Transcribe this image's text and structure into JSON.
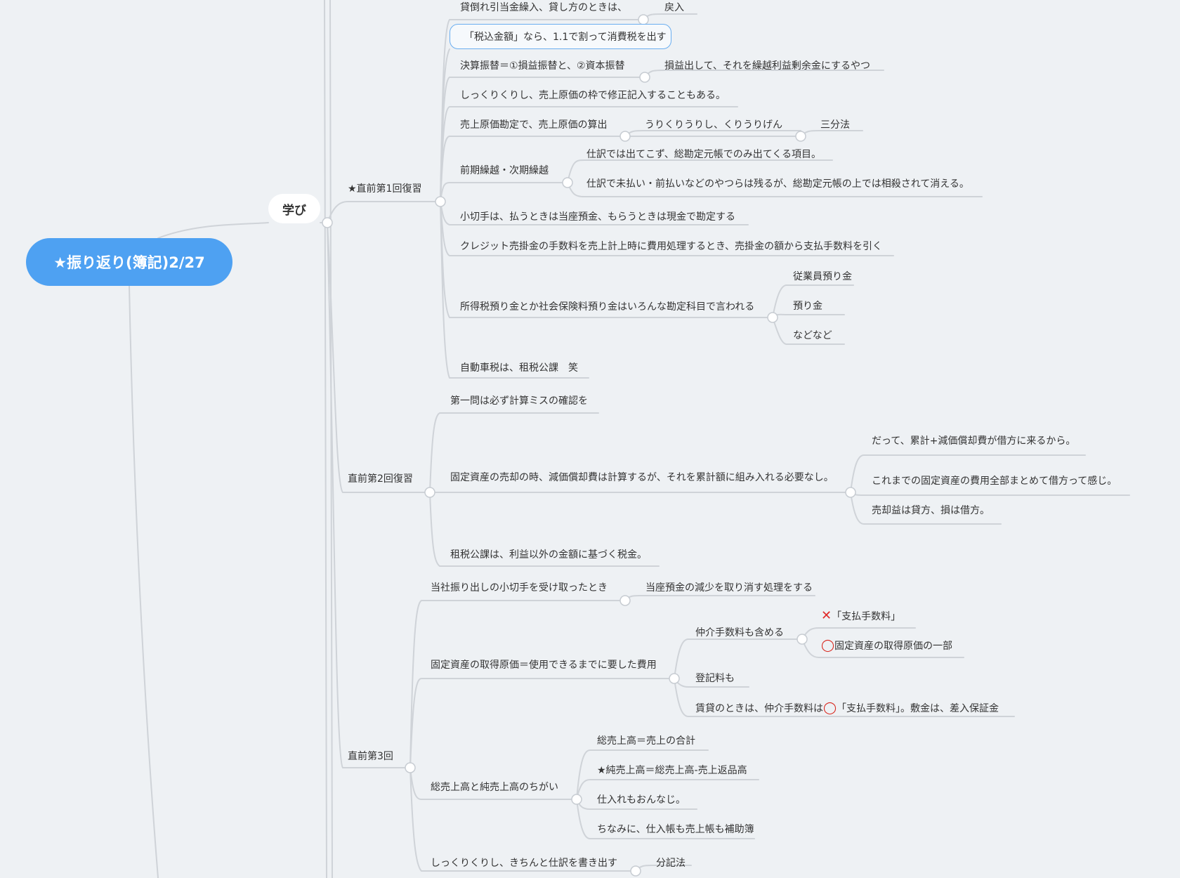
{
  "root": {
    "title": "★振り返り(簿記)2/27"
  },
  "main": {
    "label": "学び"
  },
  "branches": {
    "b1": "★直前第1回復習",
    "b2": "直前第2回復習",
    "b3": "直前第3回"
  },
  "items": {
    "t_kashidaore": "貸倒れ引当金繰入、貸し方のときは、",
    "t_modoshi": "戻入",
    "t_zeikomi": "「税込金額」なら、1.1で割って消費税を出す",
    "t_kessan": "決算振替＝①損益振替と、②資本振替",
    "t_kessan_child": "損益出して、それを繰越利益剰余金にするやつ",
    "t_shikkuri1": "しっくりくりし、売上原価の枠で修正記入することもある。",
    "t_uriage_genka": "売上原価勘定で、売上原価の算出",
    "t_urikuri": "うりくりうりし、くりうりげん",
    "t_sanbun": "三分法",
    "t_zenki": "前期繰越・次期繰越",
    "t_zenki_c1": "仕訳では出てこず、総勘定元帳でのみ出てくる項目。",
    "t_zenki_c2": "仕訳で未払い・前払いなどのやつらは残るが、総勘定元帳の上では相殺されて消える。",
    "t_kogitte": "小切手は、払うときは当座預金、もらうときは現金で勘定する",
    "t_credit": "クレジット売掛金の手数料を売上計上時に費用処理するとき、売掛金の額から支払手数料を引く",
    "t_shotoku": "所得税預り金とか社会保険料預り金はいろんな勘定科目で言われる",
    "t_jugyoin": "従業員預り金",
    "t_azukari": "預り金",
    "t_nadonado": "などなど",
    "t_jidousha": "自動車税は、租税公課　笑",
    "t_daiichimon": "第一問は必ず計算ミスの確認を",
    "t_kotei_baikyaku": "固定資産の売却の時、減価償却費は計算するが、それを累計額に組み入れる必要なし。",
    "t_datte": "だって、累計+減価償却費が借方に来るから。",
    "t_koremade": "これまでの固定資産の費用全部まとめて借方って感じ。",
    "t_baikyakueki": "売却益は貸方、損は借方。",
    "t_sozei": "租税公課は、利益以外の金額に基づく税金。",
    "t_tousha": "当社振り出しの小切手を受け取ったとき",
    "t_touza": "当座預金の減少を取り消す処理をする",
    "t_kotei_shutoku": "固定資産の取得原価＝使用できるまでに要した費用",
    "t_chukai": "仲介手数料も含める",
    "t_shiharai_x": "「支払手数料」",
    "t_shiharai_o": "固定資産の取得原価の一部",
    "t_touki": "登記料も",
    "t_chintai_a": "賃貸のときは、仲介手数料は",
    "t_chintai_b": "「支払手数料」。敷金は、差入保証金",
    "t_sou_jun": "総売上高と純売上高のちがい",
    "t_souuriage": "総売上高＝売上の合計",
    "t_junuriage": "★純売上高＝総売上高-売上返品高",
    "t_shiire": "仕入れもおんなじ。",
    "t_chinamini": "ちなみに、仕入帳も売上帳も補助簿",
    "t_shikkuri2": "しっくりくりし、きちんと仕訳を書き出す",
    "t_bunki": "分記法"
  },
  "marks": {
    "x": "✕",
    "o": "◯"
  },
  "colors": {
    "root": "#4ea1f2",
    "line": "#cfd3d8",
    "background": "#eef1f4",
    "selection": "#6aaef0"
  }
}
